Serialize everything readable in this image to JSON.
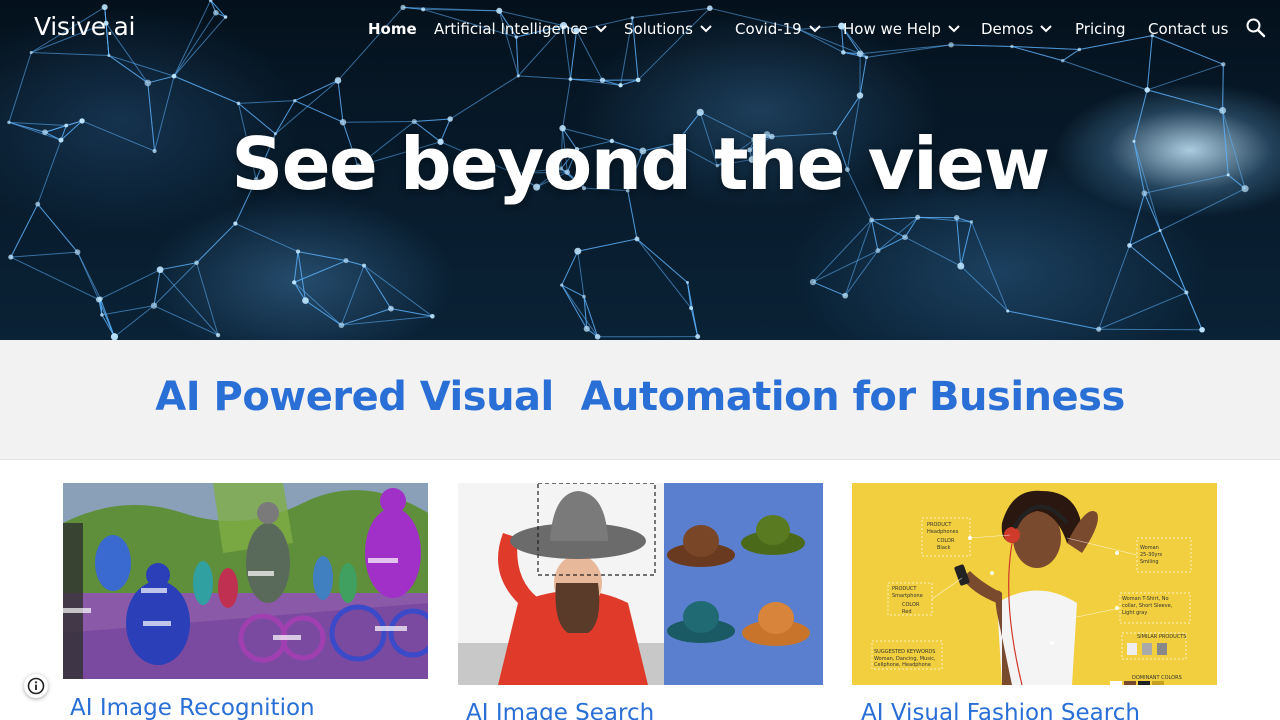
{
  "brand": {
    "name": "Visive.ai"
  },
  "nav": {
    "items": [
      {
        "label": "Home",
        "active": true,
        "dropdown": false
      },
      {
        "label": "Artificial Intelligence",
        "active": false,
        "dropdown": true
      },
      {
        "label": "Solutions",
        "active": false,
        "dropdown": true
      },
      {
        "label": "Covid-19",
        "active": false,
        "dropdown": true
      },
      {
        "label": "How we Help",
        "active": false,
        "dropdown": true
      },
      {
        "label": "Demos",
        "active": false,
        "dropdown": true
      },
      {
        "label": "Pricing",
        "active": false,
        "dropdown": false
      },
      {
        "label": "Contact us",
        "active": false,
        "dropdown": false
      }
    ],
    "search_icon": "search-icon"
  },
  "hero": {
    "title": "See beyond the view"
  },
  "section": {
    "title": "AI Powered Visual  Automation for Business"
  },
  "cards": [
    {
      "title": "AI Image Recognition",
      "image": "street-segmentation"
    },
    {
      "title": "AI Image Search",
      "image": "hat-search"
    },
    {
      "title": "AI Visual Fashion Search",
      "image": "fashion-tags"
    }
  ],
  "colors": {
    "accent": "#2a6fd6",
    "band_bg": "#f2f2f2",
    "hero_bg": "#071a2a",
    "fashion_bg": "#f2cf3e",
    "hat_panel_bg": "#5b7fcf"
  }
}
